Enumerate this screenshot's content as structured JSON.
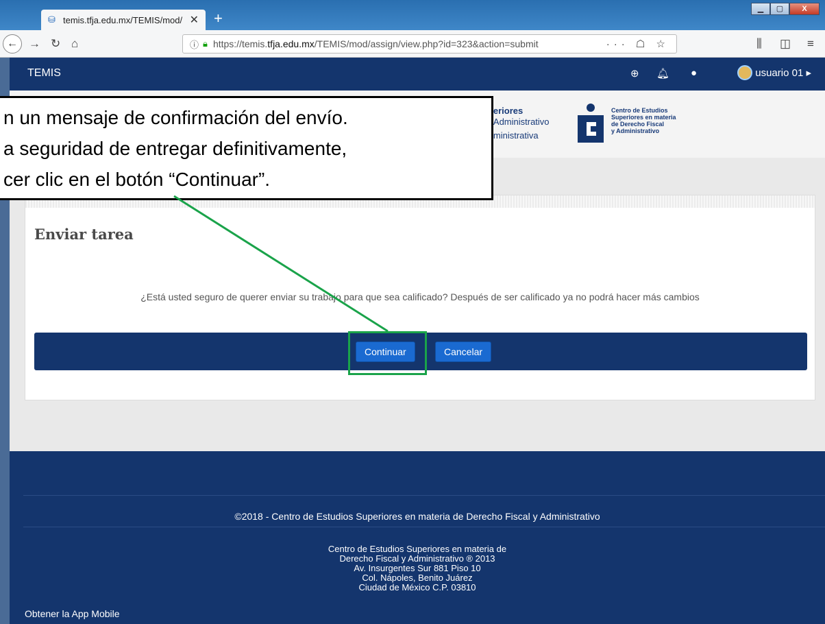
{
  "browser": {
    "tab_title": "temis.tfja.edu.mx/TEMIS/mod/",
    "tab_close": "✕",
    "new_tab": "+",
    "url_prefix": "https://temis.",
    "url_domain": "tfja.edu.mx",
    "url_path": "/TEMIS/mod/assign/view.php?id=323&action=submit",
    "url_actions": "··· ☖ ☆",
    "win_min": "▁",
    "win_max": "▢",
    "win_close": "X"
  },
  "site": {
    "brand": "TEMIS",
    "user_name": "usuario 01 ▸",
    "logo_left_lines": [
      "uperiores",
      "l y Administrativo",
      "Administrativa"
    ],
    "logo_right_lines": [
      "Centro de Estudios",
      "Superiores en materia",
      "de Derecho Fiscal",
      "y Administrativo"
    ]
  },
  "page": {
    "title": "Enviar tarea",
    "confirm_text": "¿Está usted seguro de querer enviar su trabajo para que sea calificado? Después de ser calificado ya no podrá hacer más cambios",
    "continue_label": "Continuar",
    "cancel_label": "Cancelar"
  },
  "footer": {
    "copyright": "©2018 - Centro de Estudios Superiores en materia de Derecho Fiscal y Administrativo",
    "address_lines": [
      "Centro de Estudios Superiores en materia de",
      "Derecho Fiscal y Administrativo ® 2013",
      "Av. Insurgentes Sur 881 Piso 10",
      "Col. Nápoles, Benito Juárez",
      "Ciudad de México C.P. 03810"
    ],
    "app_link": "Obtener la App Mobile"
  },
  "callout": {
    "lines": [
      "n un mensaje de confirmación del envío.",
      "a seguridad de entregar definitivamente,",
      "cer clic en el botón “Continuar”."
    ]
  },
  "colors": {
    "site_navy": "#14356d",
    "button_blue": "#1a6ad1",
    "highlight_green": "#1aa34a"
  }
}
